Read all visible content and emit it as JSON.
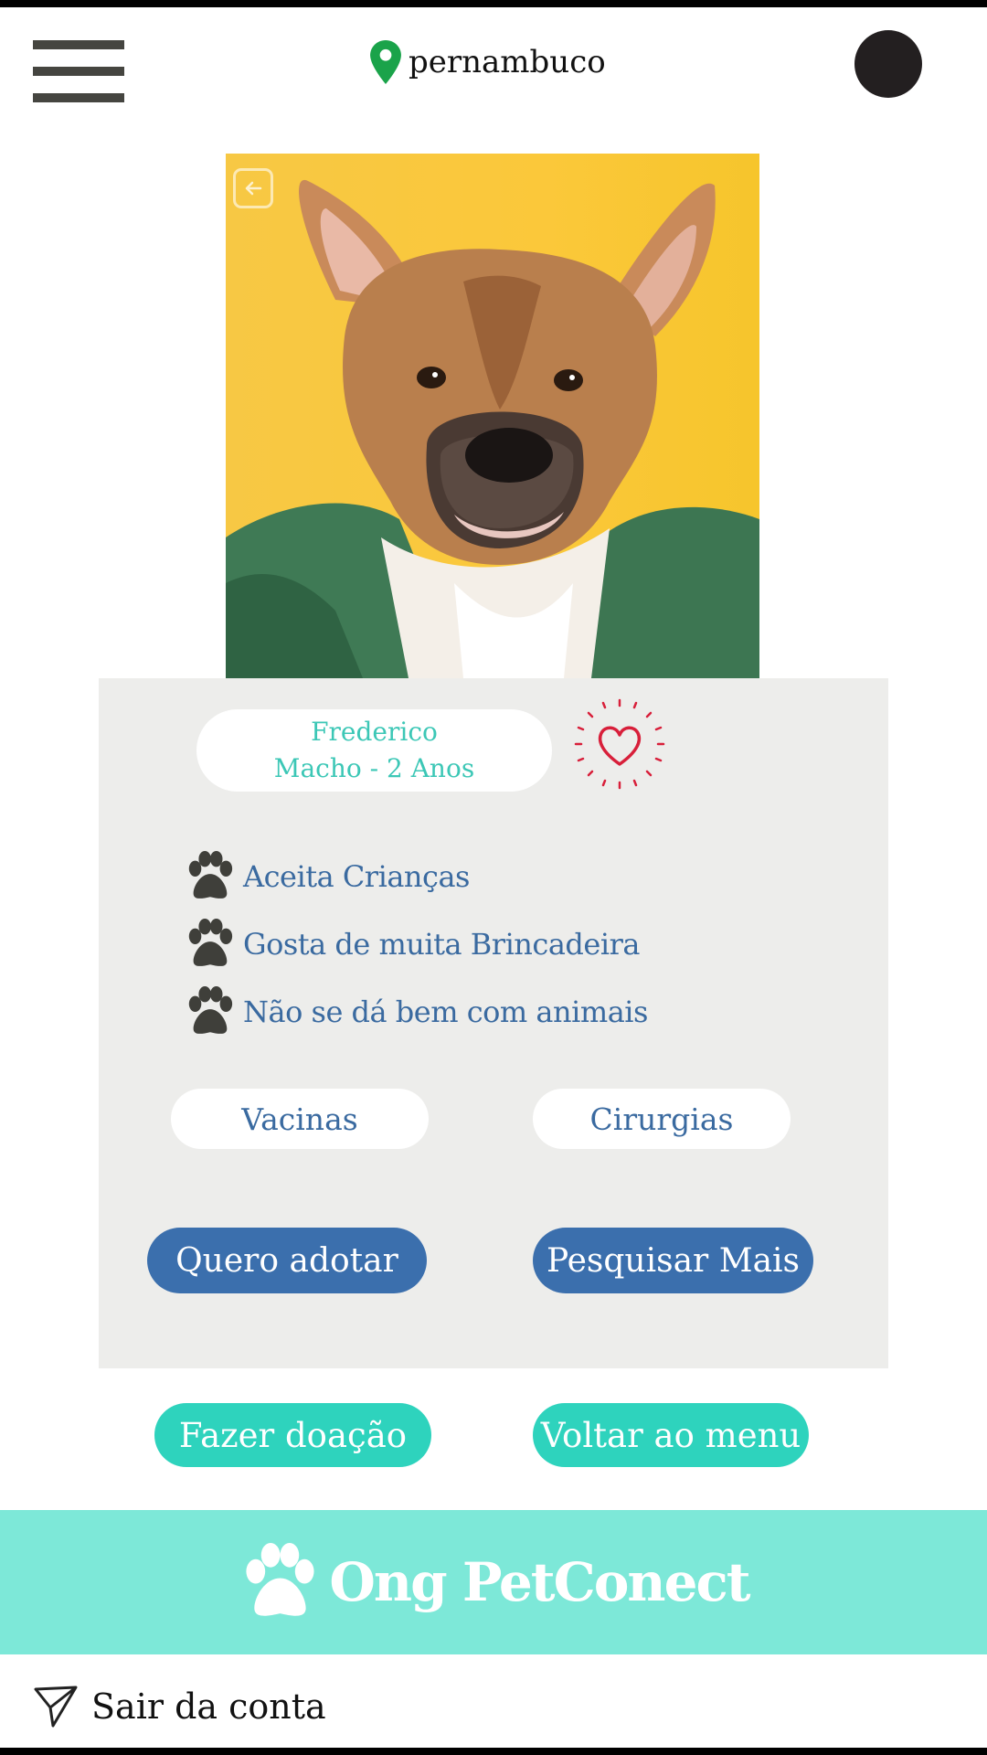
{
  "header": {
    "location": "pernambuco"
  },
  "pet": {
    "name": "Frederico",
    "details": "Macho -  2 Anos"
  },
  "traits": [
    "Aceita Crianças",
    "Gosta de muita Brincadeira",
    "Não se dá bem com animais"
  ],
  "buttons": {
    "vaccines": "Vacinas",
    "surgeries": "Cirurgias",
    "adopt": "Quero adotar",
    "search_more": "Pesquisar Mais",
    "donate": "Fazer doação",
    "back_menu": "Voltar ao menu"
  },
  "brand": {
    "name": "Ong PetConect"
  },
  "footer": {
    "logout": "Sair da  conta"
  },
  "colors": {
    "teal": "#2ed3bd",
    "brand_band": "#7de8d8",
    "blue": "#3b6fad",
    "heart": "#d81f3a",
    "location_pin": "#1aa34a"
  }
}
